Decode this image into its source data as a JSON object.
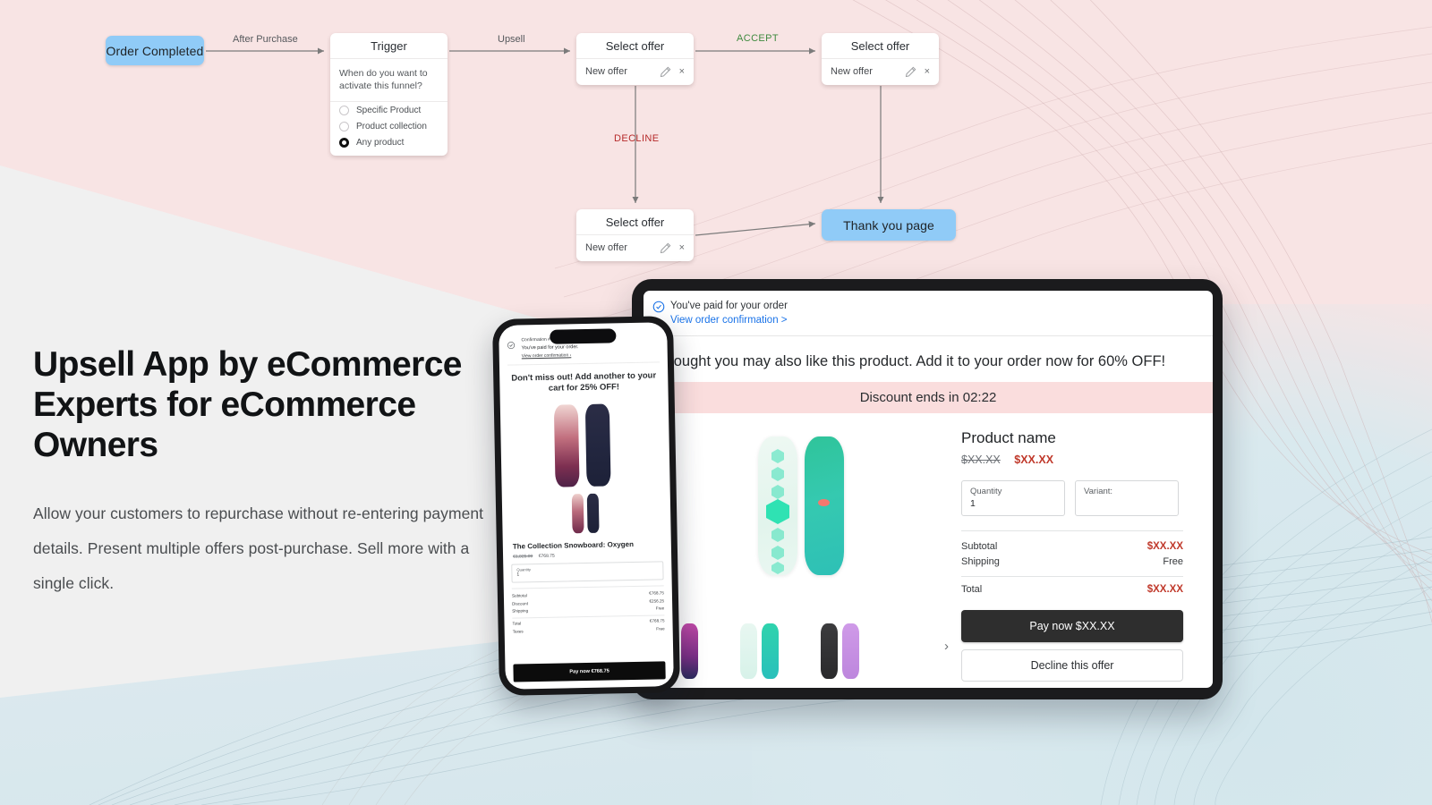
{
  "theme": {
    "pink_bg": "#F8E4E4",
    "gray_bg": "#F0F0F0",
    "blue_bg": "#D4E6EC",
    "node_blue": "#90CBF7",
    "accept_green": "#3F8A3F",
    "decline_red": "#B62A2A",
    "price_red": "#C0392B",
    "link_blue": "#1A73E8"
  },
  "flow": {
    "nodes": {
      "order_completed": "Order Completed",
      "thank_you": "Thank you page"
    },
    "trigger": {
      "title": "Trigger",
      "question": "When do you want to activate this funnel?",
      "options": [
        {
          "label": "Specific Product",
          "selected": false
        },
        {
          "label": "Product collection",
          "selected": false
        },
        {
          "label": "Any product",
          "selected": true
        }
      ]
    },
    "offer_cards": [
      {
        "title": "Select offer",
        "row_label": "New offer",
        "edit_icon": "pencil-icon",
        "close_icon": "close-icon"
      },
      {
        "title": "Select offer",
        "row_label": "New offer",
        "edit_icon": "pencil-icon",
        "close_icon": "close-icon"
      },
      {
        "title": "Select offer",
        "row_label": "New offer",
        "edit_icon": "pencil-icon",
        "close_icon": "close-icon"
      }
    ],
    "edges": {
      "after_purchase": "After Purchase",
      "upsell": "Upsell",
      "accept": "ACCEPT",
      "decline": "DECLINE"
    }
  },
  "copy": {
    "headline": "Upsell App by eCommerce Experts for eCommerce Owners",
    "body": "Allow your customers to repurchase without re-entering payment details. Present multiple offers post-purchase. Sell more with a single click."
  },
  "tablet": {
    "confirm": {
      "check_icon": "check-circle-icon",
      "paid_text": "You've paid for your order",
      "link_text": "View order confirmation >"
    },
    "offer_headline": "thought you may also like this product. Add it to your order now for 60% OFF!",
    "timer_text": "Discount ends in 02:22",
    "product": {
      "name": "Product name",
      "old_price": "$XX.XX",
      "new_price": "$XX.XX"
    },
    "fields": {
      "quantity_label": "Quantity",
      "quantity_value": "1",
      "variant_label": "Variant:",
      "variant_value": ""
    },
    "summary": [
      {
        "label": "Subtotal",
        "value": "$XX.XX",
        "accent": true
      },
      {
        "label": "Shipping",
        "value": "Free",
        "accent": false
      },
      {
        "label": "Total",
        "value": "$XX.XX",
        "accent": true
      }
    ],
    "buttons": {
      "pay": "Pay now $XX.XX",
      "decline": "Decline this offer"
    },
    "carousel_next_icon": "chevron-right-icon"
  },
  "phone": {
    "confirm": {
      "check_icon": "check-circle-icon",
      "line1": "Confirmation #",
      "line2": "You've paid for your order.",
      "line3": "View order confirmation ›"
    },
    "headline": "Don't miss out! Add another to your cart for 25% OFF!",
    "product_name": "The Collection Snowboard: Oxygen",
    "old_price": "€1,025.00",
    "new_price": "€768.75",
    "quantity_label": "Quantity",
    "quantity_value": "1",
    "summary": [
      {
        "label": "Subtotal",
        "value": "€768.75"
      },
      {
        "label": "Discount",
        "value": "€256.25"
      },
      {
        "label": "Shipping",
        "value": "Free"
      },
      {
        "label": "Total",
        "value": "€768.75"
      },
      {
        "label": "Taxes",
        "value": "Free"
      }
    ],
    "pay_button": "Pay now €768.75"
  }
}
